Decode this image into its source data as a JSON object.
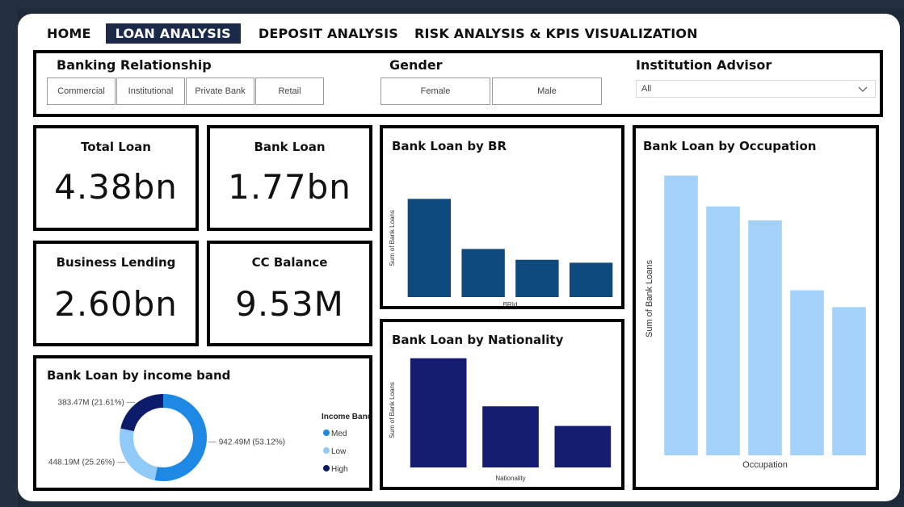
{
  "nav": {
    "tabs": [
      {
        "label": "HOME",
        "active": false
      },
      {
        "label": "LOAN ANALYSIS",
        "active": true
      },
      {
        "label": "DEPOSIT ANALYSIS",
        "active": false
      },
      {
        "label": "RISK ANALYSIS & KPIS VISUALIZATION",
        "active": false
      }
    ]
  },
  "filters": {
    "banking_relationship": {
      "title": "Banking Relationship",
      "options": [
        "Commercial",
        "Institutional",
        "Private Bank",
        "Retail"
      ]
    },
    "gender": {
      "title": "Gender",
      "options": [
        "Female",
        "Male"
      ]
    },
    "institution_advisor": {
      "title": "Institution Advisor",
      "selected": "All"
    }
  },
  "kpis": {
    "total_loan": {
      "title": "Total Loan",
      "value": "4.38bn"
    },
    "bank_loan": {
      "title": "Bank Loan",
      "value": "1.77bn"
    },
    "business_lending": {
      "title": "Business Lending",
      "value": "2.60bn"
    },
    "cc_balance": {
      "title": "CC Balance",
      "value": "9.53M"
    }
  },
  "colors": {
    "navy": "#1b2a4a",
    "br_bar": "#0e4a7e",
    "nationality_bar": "#141c70",
    "occupation_bar": "#a3d1f7",
    "donut_med": "#1e88e5",
    "donut_low": "#90caf9",
    "donut_high": "#0d1b6b"
  },
  "chart_data": [
    {
      "type": "bar",
      "title": "Bank Loan by BR",
      "xlabel": "BRId",
      "ylabel": "Sum of Bank Loans",
      "categories": [
        "",
        "",
        "",
        ""
      ],
      "values": [
        100,
        49,
        38,
        35
      ],
      "ylim": [
        0,
        120
      ],
      "color_key": "br_bar"
    },
    {
      "type": "bar",
      "title": "Bank Loan by Nationality",
      "xlabel": "Nationality",
      "ylabel": "Sum of Bank Loans",
      "categories": [
        "",
        "",
        ""
      ],
      "values": [
        100,
        56,
        38
      ],
      "ylim": [
        0,
        105
      ],
      "color_key": "nationality_bar"
    },
    {
      "type": "bar",
      "title": "Bank Loan by Occupation",
      "xlabel": "Occupation",
      "ylabel": "Sum of Bank Loans",
      "categories": [
        "",
        "",
        "",
        "",
        ""
      ],
      "values": [
        100,
        89,
        84,
        59,
        53
      ],
      "ylim": [
        0,
        112
      ],
      "color_key": "occupation_bar"
    },
    {
      "type": "pie",
      "title": "Bank Loan by income band",
      "legend_title": "Income Band",
      "slices": [
        {
          "name": "Med",
          "value": 53.12,
          "label": "942.49M (53.12%)",
          "color_key": "donut_med"
        },
        {
          "name": "Low",
          "value": 25.26,
          "label": "448.19M (25.26%)",
          "color_key": "donut_low"
        },
        {
          "name": "High",
          "value": 21.61,
          "label": "383.47M (21.61%)",
          "color_key": "donut_high"
        }
      ]
    }
  ]
}
